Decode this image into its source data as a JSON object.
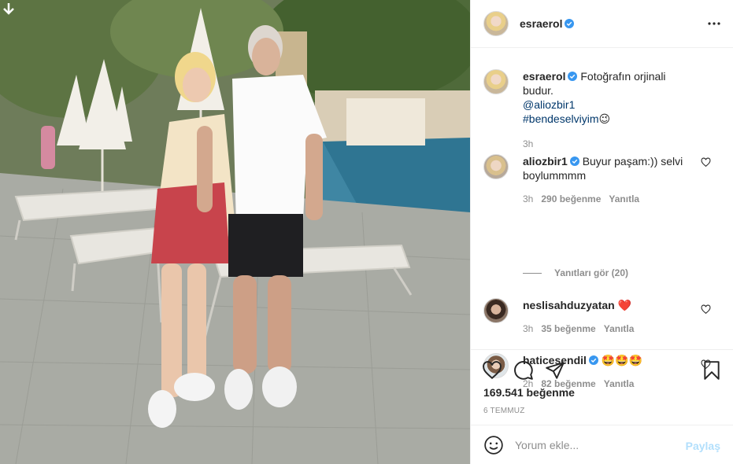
{
  "header": {
    "username": "esraerol",
    "verified": true
  },
  "caption": {
    "username": "esraerol",
    "text": "Fotoğrafın orjinali budur.",
    "mention": "@aliozbir1",
    "hashtag": "#bendeselviyim",
    "emoji": "😉",
    "time": "3h"
  },
  "comments": [
    {
      "username": "aliozbir1",
      "verified": true,
      "text": "Buyur paşam:)) selvi boylummmm",
      "time": "3h",
      "likes": "290 beğenme",
      "reply": "Yanıtla"
    },
    {
      "username": "neslisahduzyatan",
      "verified": false,
      "text": "❤️",
      "time": "3h",
      "likes": "35 beğenme",
      "reply": "Yanıtla"
    },
    {
      "username": "haticesendil",
      "verified": true,
      "text": "🤩🤩🤩",
      "time": "2h",
      "likes": "82 beğenme",
      "reply": "Yanıtla"
    }
  ],
  "view_replies": "Yanıtları gör (20)",
  "post": {
    "likes": "169.541 beğenme",
    "date": "6 TEMMUZ"
  },
  "add_comment": {
    "placeholder": "Yorum ekle...",
    "post_label": "Paylaş"
  },
  "colors": {
    "link": "#00376b",
    "verified": "#3897f0",
    "muted": "#8e8e8e",
    "post_disabled": "#b2dffc",
    "heart": "#ed4956"
  },
  "icons": [
    "download-arrow-icon",
    "more-options-icon",
    "verified-badge-icon",
    "heart-icon",
    "comment-icon",
    "share-icon",
    "bookmark-icon",
    "emoji-icon"
  ]
}
